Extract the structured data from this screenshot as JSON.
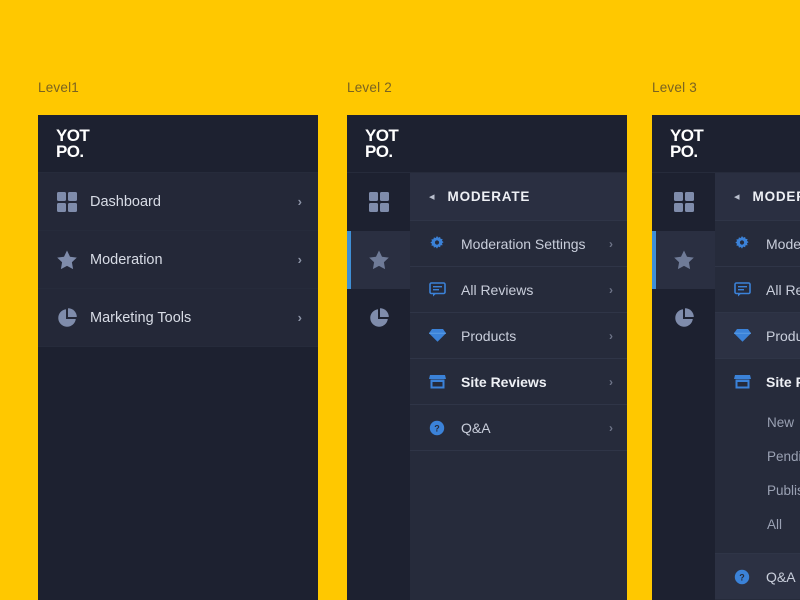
{
  "theme": {
    "background": "#FFC800",
    "panel_bg": "#1d2130",
    "submenu_bg": "#262b3b",
    "accent_blue": "#3f8fd6",
    "icon_blue": "#3b82d8",
    "label_color": "#7a6322"
  },
  "brand": {
    "line1": "YOT",
    "line2": "PO."
  },
  "levels": [
    {
      "label": "Level1"
    },
    {
      "label": "Level 2"
    },
    {
      "label": "Level 3"
    }
  ],
  "level1": {
    "items": [
      {
        "label": "Dashboard",
        "icon": "grid-icon",
        "chevron": "›"
      },
      {
        "label": "Moderation",
        "icon": "star-icon",
        "chevron": "›"
      },
      {
        "label": "Marketing Tools",
        "icon": "pie-chart-icon",
        "chevron": "›"
      }
    ]
  },
  "rail": {
    "items": [
      {
        "icon": "grid-icon",
        "active": false
      },
      {
        "icon": "star-icon",
        "active": true
      },
      {
        "icon": "pie-chart-icon",
        "active": false
      }
    ]
  },
  "submenu": {
    "back_arrow": "◂",
    "title": "MODERATE",
    "items": [
      {
        "label": "Moderation Settings",
        "icon": "gear-icon",
        "chevron": "›"
      },
      {
        "label": "All Reviews",
        "icon": "comment-icon",
        "chevron": "›"
      },
      {
        "label": "Products",
        "icon": "diamond-icon",
        "chevron": "›"
      },
      {
        "label": "Site Reviews",
        "icon": "store-icon",
        "chevron": "›"
      },
      {
        "label": "Q&A",
        "icon": "question-icon",
        "chevron": "›"
      }
    ]
  },
  "level3_submenu": {
    "back_arrow": "◂",
    "title": "MODERATE",
    "items": [
      {
        "label": "Moderation Settings",
        "icon": "gear-icon"
      },
      {
        "label": "All Reviews",
        "icon": "comment-icon"
      },
      {
        "label": "Products",
        "icon": "diamond-icon"
      },
      {
        "label": "Site Reviews",
        "icon": "store-icon"
      },
      {
        "label": "Q&A",
        "icon": "question-icon"
      }
    ],
    "site_reviews_children": [
      {
        "label": "New"
      },
      {
        "label": "Pending"
      },
      {
        "label": "Published"
      },
      {
        "label": "All"
      }
    ]
  }
}
